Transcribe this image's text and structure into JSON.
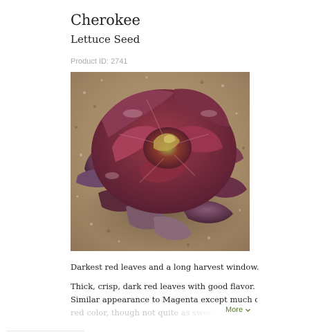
{
  "product": {
    "title": "Cherokee",
    "subtitle": "Lettuce Seed",
    "id_label": "Product ID: 2741",
    "image_icon": "lettuce-photo",
    "tagline": "Darkest red leaves and a long harvest window.",
    "description_lines": [
      "Thick, crisp, dark red leaves with good flavor.",
      "Similar appearance to Magenta except much darker",
      "red color, though not quite as sweet. Very s"
    ],
    "more_label": "More",
    "more_icon": "chevron-down-icon"
  },
  "colors": {
    "link": "#5a7b33",
    "muted_text": "#a9a9a9",
    "body_text": "#222222"
  }
}
